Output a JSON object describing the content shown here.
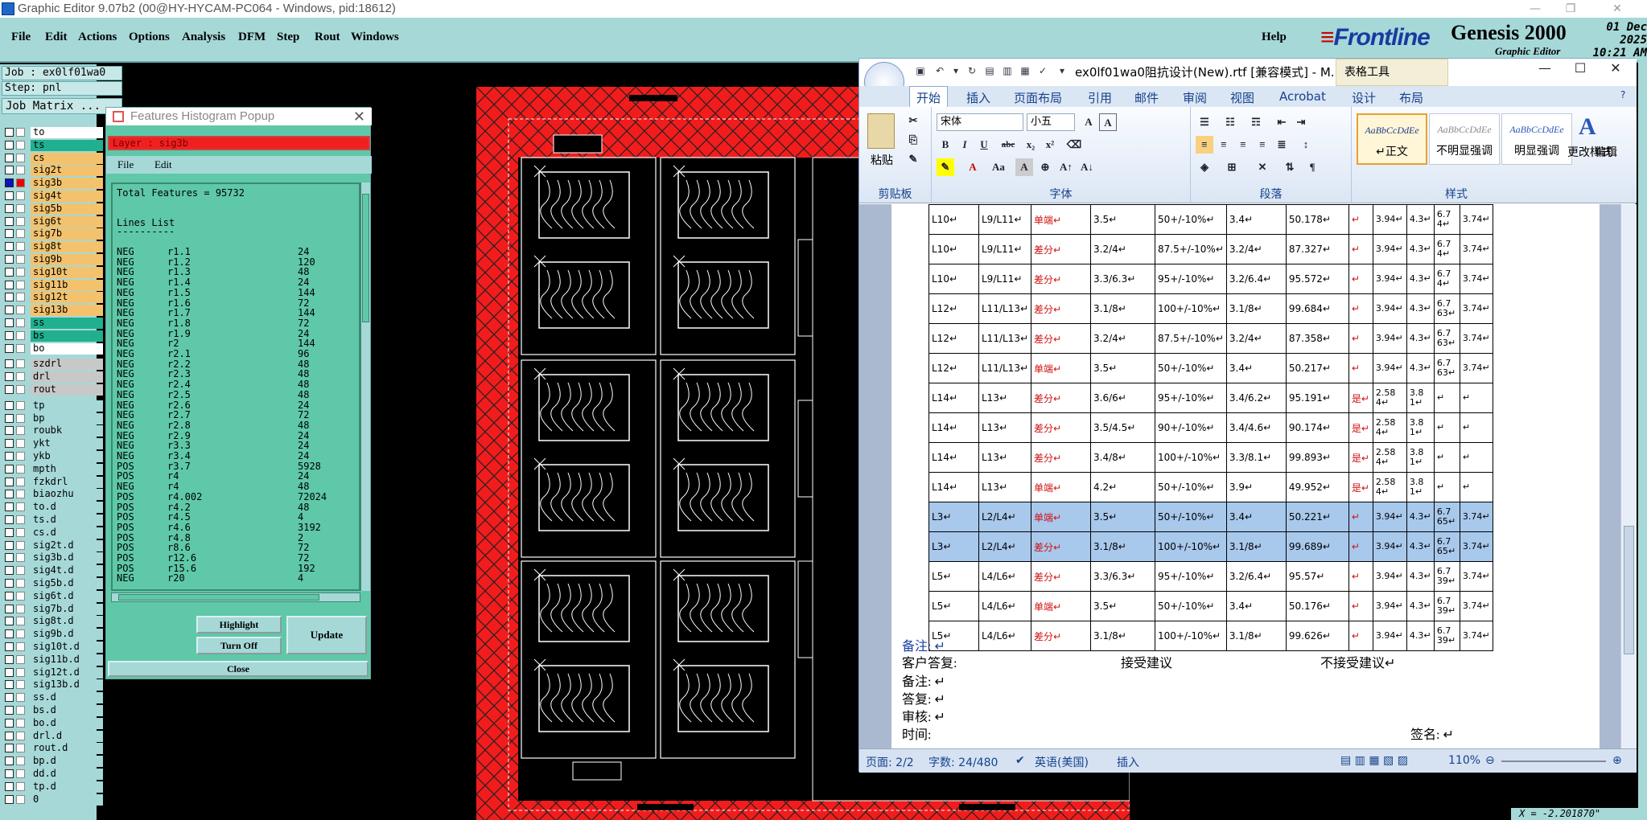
{
  "window_title": "Graphic Editor 9.07b2 (00@HY-HYCAM-PC064 - Windows, pid:18612)",
  "menu": [
    "File",
    "Edit",
    "Actions",
    "Options",
    "Analysis",
    "DFM",
    "Step",
    "Rout",
    "Windows"
  ],
  "help": "Help",
  "brand": {
    "logo_a": "Front",
    "logo_b": "line",
    "product": "Genesis 2000",
    "sub": "Graphic Editor",
    "date": "01 Dec 2025",
    "time": "10:21 AM"
  },
  "job": "Job : ex0lf01wa0",
  "step": "Step: pnl",
  "job_matrix": "Job Matrix ...",
  "layers": [
    {
      "name": "to",
      "style": "white"
    },
    {
      "name": "ts",
      "style": "green"
    },
    {
      "name": "cs",
      "style": "sig"
    },
    {
      "name": "sig2t",
      "style": "sig"
    },
    {
      "name": "sig3b",
      "style": "sig",
      "selected": true
    },
    {
      "name": "sig4t",
      "style": "sig"
    },
    {
      "name": "sig5b",
      "style": "sig"
    },
    {
      "name": "sig6t",
      "style": "sig"
    },
    {
      "name": "sig7b",
      "style": "sig"
    },
    {
      "name": "sig8t",
      "style": "sig"
    },
    {
      "name": "sig9b",
      "style": "sig"
    },
    {
      "name": "sig10t",
      "style": "sig"
    },
    {
      "name": "sig11b",
      "style": "sig"
    },
    {
      "name": "sig12t",
      "style": "sig"
    },
    {
      "name": "sig13b",
      "style": "sig"
    },
    {
      "name": "ss",
      "style": "green"
    },
    {
      "name": "bs",
      "style": "green"
    },
    {
      "name": "bo",
      "style": "white"
    },
    {
      "name": "szdrl",
      "style": "grey"
    },
    {
      "name": "drl",
      "style": "grey"
    },
    {
      "name": "rout",
      "style": "grey"
    },
    {
      "name": "tp",
      "style": "cyan"
    },
    {
      "name": "bp",
      "style": "cyan"
    },
    {
      "name": "roubk",
      "style": "cyan"
    },
    {
      "name": "ykt",
      "style": "cyan"
    },
    {
      "name": "ykb",
      "style": "cyan"
    },
    {
      "name": "mpth",
      "style": "cyan"
    },
    {
      "name": "fzkdrl",
      "style": "cyan"
    },
    {
      "name": "biaozhu",
      "style": "cyan"
    },
    {
      "name": "to.d",
      "style": "cyan"
    },
    {
      "name": "ts.d",
      "style": "cyan"
    },
    {
      "name": "cs.d",
      "style": "cyan"
    },
    {
      "name": "sig2t.d",
      "style": "cyan"
    },
    {
      "name": "sig3b.d",
      "style": "cyan"
    },
    {
      "name": "sig4t.d",
      "style": "cyan"
    },
    {
      "name": "sig5b.d",
      "style": "cyan"
    },
    {
      "name": "sig6t.d",
      "style": "cyan"
    },
    {
      "name": "sig7b.d",
      "style": "cyan"
    },
    {
      "name": "sig8t.d",
      "style": "cyan"
    },
    {
      "name": "sig9b.d",
      "style": "cyan"
    },
    {
      "name": "sig10t.d",
      "style": "cyan"
    },
    {
      "name": "sig11b.d",
      "style": "cyan"
    },
    {
      "name": "sig12t.d",
      "style": "cyan"
    },
    {
      "name": "sig13b.d",
      "style": "cyan"
    },
    {
      "name": "ss.d",
      "style": "cyan"
    },
    {
      "name": "bs.d",
      "style": "cyan"
    },
    {
      "name": "bo.d",
      "style": "cyan"
    },
    {
      "name": "drl.d",
      "style": "cyan"
    },
    {
      "name": "rout.d",
      "style": "cyan"
    },
    {
      "name": "bp.d",
      "style": "cyan"
    },
    {
      "name": "dd.d",
      "style": "cyan"
    },
    {
      "name": "tp.d",
      "style": "cyan"
    },
    {
      "name": "0",
      "style": "cyan"
    }
  ],
  "histogram": {
    "title": "Features Histogram Popup",
    "layer": "Layer :  sig3b",
    "menu": [
      "File",
      "Edit"
    ],
    "total": "Total Features = 95732",
    "list_title": "Lines List",
    "underline": "----------",
    "rows": [
      [
        "NEG",
        "r1.1",
        "24"
      ],
      [
        "NEG",
        "r1.2",
        "120"
      ],
      [
        "NEG",
        "r1.3",
        "48"
      ],
      [
        "NEG",
        "r1.4",
        "24"
      ],
      [
        "NEG",
        "r1.5",
        "144"
      ],
      [
        "NEG",
        "r1.6",
        "72"
      ],
      [
        "NEG",
        "r1.7",
        "144"
      ],
      [
        "NEG",
        "r1.8",
        "72"
      ],
      [
        "NEG",
        "r1.9",
        "24"
      ],
      [
        "NEG",
        "r2",
        "144"
      ],
      [
        "NEG",
        "r2.1",
        "96"
      ],
      [
        "NEG",
        "r2.2",
        "48"
      ],
      [
        "NEG",
        "r2.3",
        "48"
      ],
      [
        "NEG",
        "r2.4",
        "48"
      ],
      [
        "NEG",
        "r2.5",
        "48"
      ],
      [
        "NEG",
        "r2.6",
        "24"
      ],
      [
        "NEG",
        "r2.7",
        "72"
      ],
      [
        "NEG",
        "r2.8",
        "48"
      ],
      [
        "NEG",
        "r2.9",
        "24"
      ],
      [
        "NEG",
        "r3.3",
        "24"
      ],
      [
        "NEG",
        "r3.4",
        "24"
      ],
      [
        "POS",
        "r3.7",
        "5928"
      ],
      [
        "POS",
        "r4",
        "24"
      ],
      [
        "NEG",
        "r4",
        "48"
      ],
      [
        "POS",
        "r4.002",
        "72024"
      ],
      [
        "POS",
        "r4.2",
        "48"
      ],
      [
        "POS",
        "r4.5",
        "4"
      ],
      [
        "POS",
        "r4.6",
        "3192"
      ],
      [
        "POS",
        "r4.8",
        "2"
      ],
      [
        "POS",
        "r8.6",
        "72"
      ],
      [
        "POS",
        "r12.6",
        "72"
      ],
      [
        "POS",
        "r15.6",
        "192"
      ],
      [
        "NEG",
        "r20",
        "4"
      ]
    ],
    "highlight": "Highlight",
    "turn_off": "Turn Off",
    "update": "Update",
    "close": "Close"
  },
  "word": {
    "title": "ex0lf01wa0阻抗设计(New).rtf [兼容模式] - M...",
    "context_tab": "表格工具",
    "tabs": [
      "开始",
      "插入",
      "页面布局",
      "引用",
      "邮件",
      "审阅",
      "视图",
      "Acrobat",
      "设计",
      "布局"
    ],
    "font_name": "宋体",
    "font_size": "小五",
    "groups": [
      "剪贴板",
      "字体",
      "段落",
      "样式"
    ],
    "paste": "粘贴",
    "styles": [
      {
        "preview": "AaBbCcDdEe",
        "name": "↵正文"
      },
      {
        "preview": "AaBbCcDdEe",
        "name": "不明显强调"
      },
      {
        "preview": "AaBbCcDdEe",
        "name": "明显强调"
      }
    ],
    "change_styles": "更改样式",
    "edit": "编辑",
    "table_rows": [
      [
        "L10↵",
        "L9/L11↵",
        "单端↵",
        "3.5↵",
        "50+/-10%↵",
        "3.4↵",
        "50.178↵",
        "↵",
        "3.94↵",
        "4.3↵",
        "6.7 4↵",
        "3.74↵"
      ],
      [
        "L10↵",
        "L9/L11↵",
        "差分↵",
        "3.2/4↵",
        "87.5+/-10%↵",
        "3.2/4↵",
        "87.327↵",
        "↵",
        "3.94↵",
        "4.3↵",
        "6.7 4↵",
        "3.74↵"
      ],
      [
        "L10↵",
        "L9/L11↵",
        "差分↵",
        "3.3/6.3↵",
        "95+/-10%↵",
        "3.2/6.4↵",
        "95.572↵",
        "↵",
        "3.94↵",
        "4.3↵",
        "6.7 4↵",
        "3.74↵"
      ],
      [
        "L12↵",
        "L11/L13↵",
        "差分↵",
        "3.1/8↵",
        "100+/-10%↵",
        "3.1/8↵",
        "99.684↵",
        "↵",
        "3.94↵",
        "4.3↵",
        "6.7 63↵",
        "3.74↵"
      ],
      [
        "L12↵",
        "L11/L13↵",
        "差分↵",
        "3.2/4↵",
        "87.5+/-10%↵",
        "3.2/4↵",
        "87.358↵",
        "↵",
        "3.94↵",
        "4.3↵",
        "6.7 63↵",
        "3.74↵"
      ],
      [
        "L12↵",
        "L11/L13↵",
        "单端↵",
        "3.5↵",
        "50+/-10%↵",
        "3.4↵",
        "50.217↵",
        "↵",
        "3.94↵",
        "4.3↵",
        "6.7 63↵",
        "3.74↵"
      ],
      [
        "L14↵",
        "L13↵",
        "差分↵",
        "3.6/6↵",
        "95+/-10%↵",
        "3.4/6.2↵",
        "95.191↵",
        "是↵",
        "2.58 4↵",
        "3.8 1↵",
        "↵",
        "↵"
      ],
      [
        "L14↵",
        "L13↵",
        "差分↵",
        "3.5/4.5↵",
        "90+/-10%↵",
        "3.4/4.6↵",
        "90.174↵",
        "是↵",
        "2.58 4↵",
        "3.8 1↵",
        "↵",
        "↵"
      ],
      [
        "L14↵",
        "L13↵",
        "差分↵",
        "3.4/8↵",
        "100+/-10%↵",
        "3.3/8.1↵",
        "99.893↵",
        "是↵",
        "2.58 4↵",
        "3.8 1↵",
        "↵",
        "↵"
      ],
      [
        "L14↵",
        "L13↵",
        "单端↵",
        "4.2↵",
        "50+/-10%↵",
        "3.9↵",
        "49.952↵",
        "是↵",
        "2.58 4↵",
        "3.8 1↵",
        "↵",
        "↵"
      ],
      [
        "L3↵",
        "L2/L4↵",
        "单端↵",
        "3.5↵",
        "50+/-10%↵",
        "3.4↵",
        "50.221↵",
        "↵",
        "3.94↵",
        "4.3↵",
        "6.7 65↵",
        "3.74↵"
      ],
      [
        "L3↵",
        "L2/L4↵",
        "差分↵",
        "3.1/8↵",
        "100+/-10%↵",
        "3.1/8↵",
        "99.689↵",
        "↵",
        "3.94↵",
        "4.3↵",
        "6.7 65↵",
        "3.74↵"
      ],
      [
        "L5↵",
        "L4/L6↵",
        "差分↵",
        "3.3/6.3↵",
        "95+/-10%↵",
        "3.2/6.4↵",
        "95.57↵",
        "↵",
        "3.94↵",
        "4.3↵",
        "6.7 39↵",
        "3.74↵"
      ],
      [
        "L5↵",
        "L4/L6↵",
        "单端↵",
        "3.5↵",
        "50+/-10%↵",
        "3.4↵",
        "50.176↵",
        "↵",
        "3.94↵",
        "4.3↵",
        "6.7 39↵",
        "3.74↵"
      ],
      [
        "L5↵",
        "L4/L6↵",
        "差分↵",
        "3.1/8↵",
        "100+/-10%↵",
        "3.1/8↵",
        "99.626↵",
        "↵",
        "3.94↵",
        "4.3↵",
        "6.7 39↵",
        "3.74↵"
      ]
    ],
    "highlighted_rows": [
      10,
      11
    ],
    "notes": {
      "remark1": "备注: ↵",
      "customer": "客户答复:",
      "accept": "接受建议",
      "reject": "不接受建议↵",
      "remark2": "备注: ↵",
      "reply": "答复: ↵",
      "review": "审核: ↵",
      "time": "时间:",
      "sign": "签名: ↵"
    },
    "status": {
      "page": "页面: 2/2",
      "words": "字数: 24/480",
      "lang": "英语(美国)",
      "mode": "插入",
      "zoom": "110%"
    }
  },
  "coord": "X = -2.201870\""
}
